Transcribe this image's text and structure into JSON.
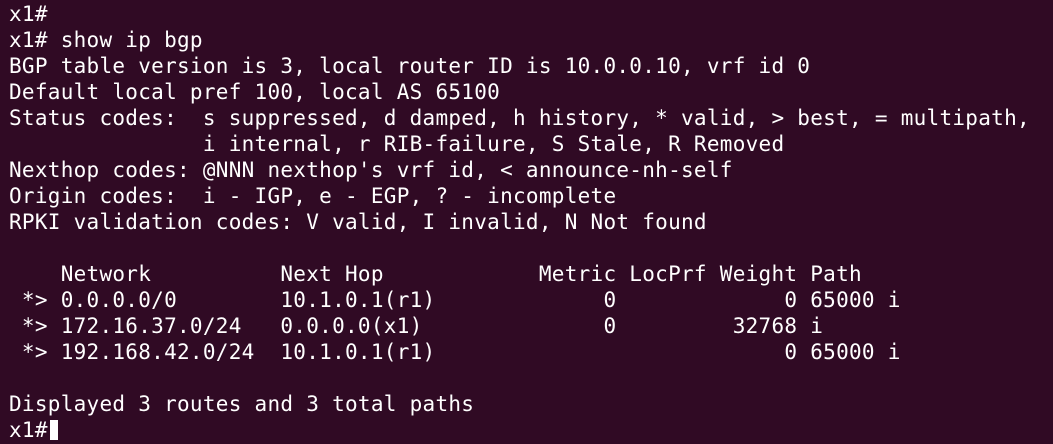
{
  "terminal": {
    "background": "#300a24",
    "foreground": "#ffffff",
    "lines": [
      "x1#",
      "x1# show ip bgp",
      "BGP table version is 3, local router ID is 10.0.0.10, vrf id 0",
      "Default local pref 100, local AS 65100",
      "Status codes:  s suppressed, d damped, h history, * valid, > best, = multipath,",
      "               i internal, r RIB-failure, S Stale, R Removed",
      "Nexthop codes: @NNN nexthop's vrf id, < announce-nh-self",
      "Origin codes:  i - IGP, e - EGP, ? - incomplete",
      "RPKI validation codes: V valid, I invalid, N Not found",
      "",
      "    Network          Next Hop            Metric LocPrf Weight Path",
      " *> 0.0.0.0/0        10.1.0.1(r1)             0             0 65000 i",
      " *> 172.16.37.0/24   0.0.0.0(x1)              0         32768 i",
      " *> 192.168.42.0/24  10.1.0.1(r1)                           0 65000 i",
      "",
      "Displayed 3 routes and 3 total paths",
      "x1#"
    ]
  }
}
